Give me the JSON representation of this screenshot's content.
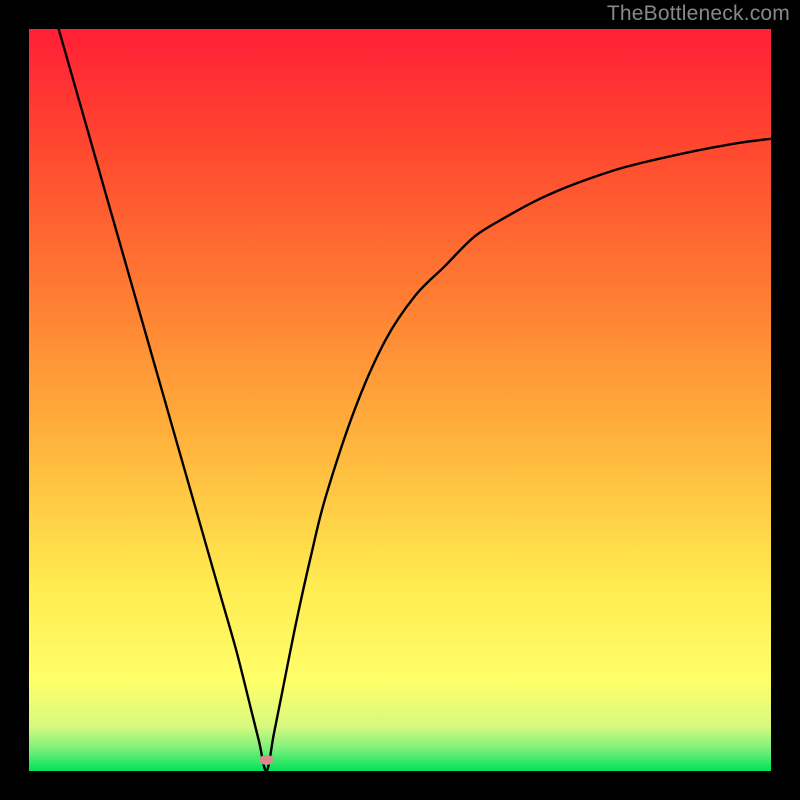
{
  "watermark": "TheBottleneck.com",
  "chart_data": {
    "type": "line",
    "title": "",
    "xlabel": "",
    "ylabel": "",
    "xlim": [
      0,
      100
    ],
    "ylim": [
      0,
      100
    ],
    "optimum_x": 32,
    "marker": {
      "x": 32,
      "y": 1.5,
      "color": "#d98b8b"
    },
    "background_gradient": [
      {
        "stop": 0,
        "color": "#00e35a"
      },
      {
        "stop": 3,
        "color": "#7bf07a"
      },
      {
        "stop": 6,
        "color": "#d7f97f"
      },
      {
        "stop": 12,
        "color": "#ffff6a"
      },
      {
        "stop": 25,
        "color": "#ffeb50"
      },
      {
        "stop": 45,
        "color": "#ffb23c"
      },
      {
        "stop": 65,
        "color": "#ff7a32"
      },
      {
        "stop": 85,
        "color": "#ff4530"
      },
      {
        "stop": 100,
        "color": "#ff1f36"
      }
    ],
    "series": [
      {
        "name": "bottleneck-curve",
        "x": [
          4,
          6,
          8,
          10,
          12,
          14,
          16,
          18,
          20,
          22,
          24,
          26,
          28,
          30,
          31,
          32,
          33,
          34,
          36,
          38,
          40,
          44,
          48,
          52,
          56,
          60,
          64,
          68,
          72,
          76,
          80,
          84,
          88,
          92,
          96,
          100
        ],
        "y": [
          100,
          93,
          86,
          79,
          72,
          65,
          58,
          51,
          44,
          37,
          30,
          23,
          16,
          8,
          4,
          0,
          5,
          10,
          20,
          29,
          37,
          49,
          58,
          64,
          68,
          72,
          74.5,
          76.7,
          78.5,
          80,
          81.3,
          82.3,
          83.2,
          84,
          84.7,
          85.2
        ]
      }
    ]
  }
}
